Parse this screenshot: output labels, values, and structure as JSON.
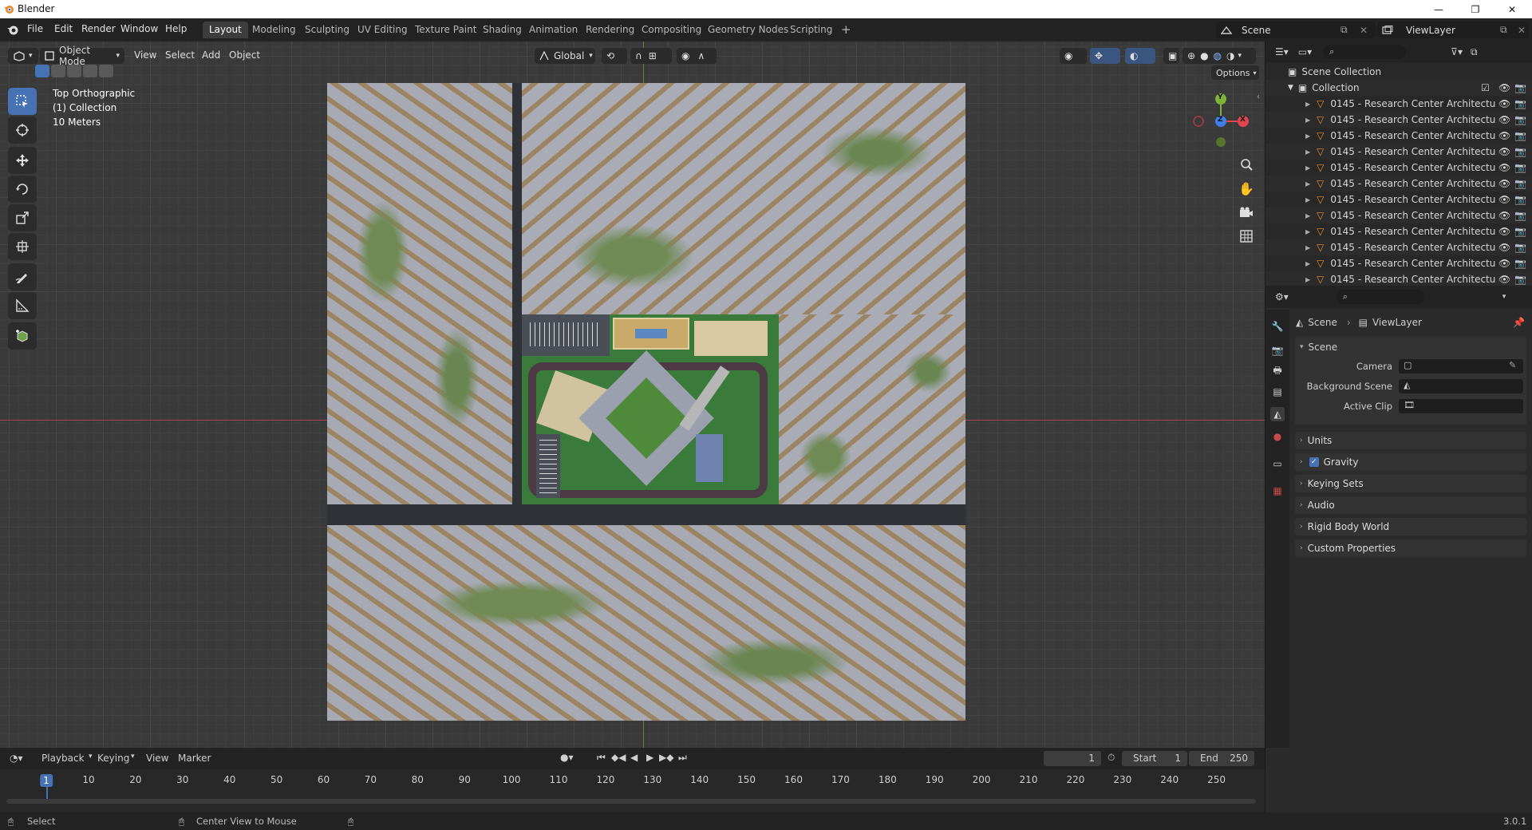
{
  "window": {
    "title": "Blender"
  },
  "menu": [
    "File",
    "Edit",
    "Render",
    "Window",
    "Help"
  ],
  "workspaces": [
    "Layout",
    "Modeling",
    "Sculpting",
    "UV Editing",
    "Texture Paint",
    "Shading",
    "Animation",
    "Rendering",
    "Compositing",
    "Geometry Nodes",
    "Scripting"
  ],
  "active_workspace": "Layout",
  "scene_selector": {
    "scene": "Scene",
    "view_layer": "ViewLayer"
  },
  "viewport_header": {
    "mode": "Object Mode",
    "menus": [
      "View",
      "Select",
      "Add",
      "Object"
    ],
    "orientation": "Global",
    "options": "Options"
  },
  "viewport_info": {
    "view": "Top Orthographic",
    "collection": "(1) Collection",
    "scale": "10 Meters"
  },
  "gizmo": {
    "y": "Y",
    "z": "Z",
    "x": "X"
  },
  "outliner": {
    "scene_collection": "Scene Collection",
    "collection": "Collection",
    "items": [
      "0145 - Research Center Architectu",
      "0145 - Research Center Architectu",
      "0145 - Research Center Architectu",
      "0145 - Research Center Architectu",
      "0145 - Research Center Architectu",
      "0145 - Research Center Architectu",
      "0145 - Research Center Architectu",
      "0145 - Research Center Architectu",
      "0145 - Research Center Architectu",
      "0145 - Research Center Architectu",
      "0145 - Research Center Architectu",
      "0145 - Research Center Architectu"
    ]
  },
  "properties": {
    "breadcrumb_scene": "Scene",
    "breadcrumb_layer": "ViewLayer",
    "panel_title": "Scene",
    "fields": {
      "camera": "Camera",
      "background_scene": "Background Scene",
      "active_clip": "Active Clip"
    },
    "sections": [
      "Units",
      "Gravity",
      "Keying Sets",
      "Audio",
      "Rigid Body World",
      "Custom Properties"
    ],
    "gravity_checked": true
  },
  "timeline": {
    "menus": [
      "Playback",
      "Keying",
      "View",
      "Marker"
    ],
    "current_frame": "1",
    "start_label": "Start",
    "start": "1",
    "end_label": "End",
    "end": "250",
    "ruler": [
      "1",
      "10",
      "20",
      "30",
      "40",
      "50",
      "60",
      "70",
      "80",
      "90",
      "100",
      "110",
      "120",
      "130",
      "140",
      "150",
      "160",
      "170",
      "180",
      "190",
      "200",
      "210",
      "220",
      "230",
      "240",
      "250"
    ]
  },
  "status": {
    "select": "Select",
    "center": "Center View to Mouse",
    "version": "3.0.1"
  },
  "colors": {
    "accent": "#4772b3",
    "x_axis": "#e0454f",
    "y_axis": "#7eb336",
    "z_axis": "#3d7fe6",
    "orange": "#e8892e"
  }
}
